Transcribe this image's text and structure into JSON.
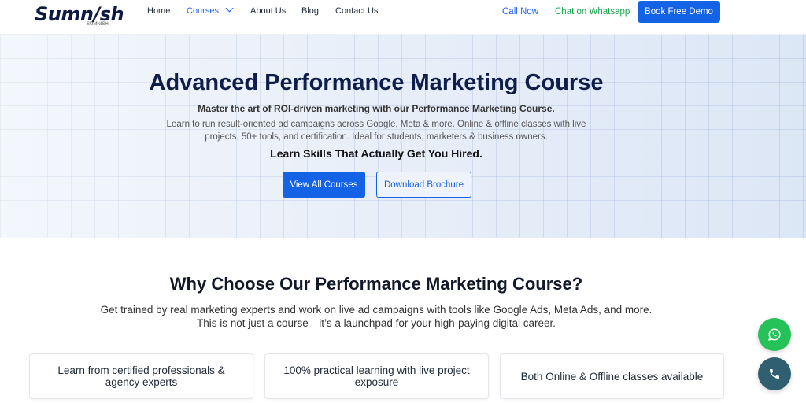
{
  "brand": {
    "logo_text": "Sumn/sh",
    "logo_sub": "SUMNISH"
  },
  "nav": {
    "items": [
      {
        "label": "Home"
      },
      {
        "label": "Courses"
      },
      {
        "label": "About Us"
      },
      {
        "label": "Blog"
      },
      {
        "label": "Contact Us"
      }
    ],
    "active": "Courses"
  },
  "header_actions": {
    "call": "Call Now",
    "whatsapp": "Chat on Whatsapp",
    "demo": "Book Free Demo"
  },
  "hero": {
    "title": "Advanced Performance Marketing Course",
    "subtitle": "Master the art of ROI-driven marketing with our Performance Marketing Course.",
    "description": "Learn to run result-oriented ad campaigns across Google, Meta & more. Online & offline classes with live projects, 50+ tools, and certification. Ideal for students, marketers & business owners.",
    "tagline": "Learn Skills That Actually Get You Hired.",
    "primary_button": "View All Courses",
    "secondary_button": "Download Brochure"
  },
  "why": {
    "title": "Why Choose Our Performance Marketing Course?",
    "line1": "Get trained by real marketing experts and work on live ad campaigns with tools like Google Ads, Meta Ads, and more.",
    "line2": "This is not just a course—it’s a launchpad for your high-paying digital career.",
    "cards": [
      {
        "text": "Learn from certified professionals & agency experts"
      },
      {
        "text": "100% practical learning with live project exposure"
      },
      {
        "text": "Both Online & Offline classes available"
      }
    ]
  },
  "floating": {
    "whatsapp_icon": "whatsapp-icon",
    "phone_icon": "phone-icon"
  },
  "colors": {
    "primary": "#1463e6",
    "navy": "#0f1d4a",
    "whatsapp": "#25c25a",
    "call_fab": "#2f5f70"
  }
}
